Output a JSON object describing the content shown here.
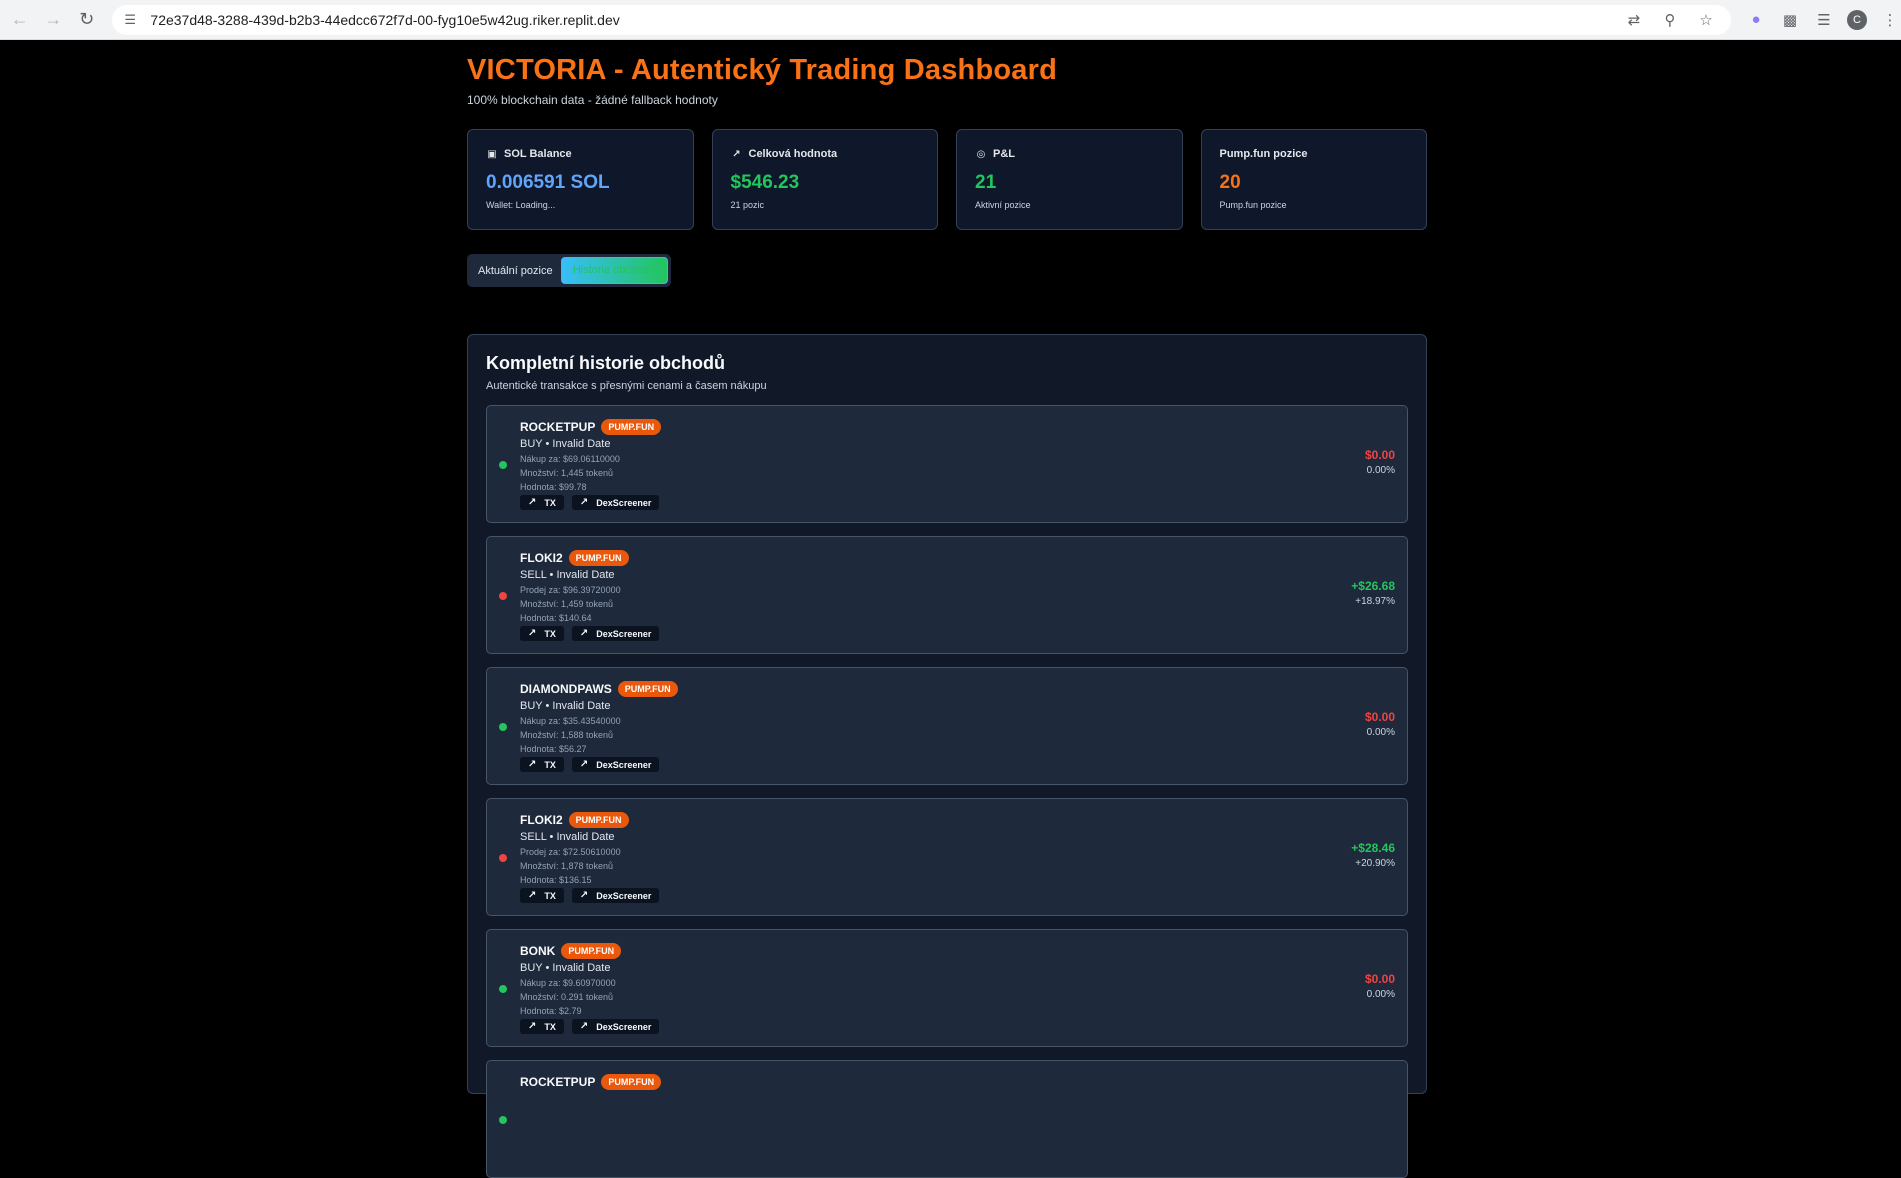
{
  "browser": {
    "url": "72e37d48-3288-439d-b2b3-44edcc672f7d-00-fyg10e5w42ug.riker.replit.dev",
    "avatar_letter": "C"
  },
  "header": {
    "title": "VICTORIA - Autentický Trading Dashboard",
    "subtitle": "100% blockchain data - žádné fallback hodnoty"
  },
  "stats": [
    {
      "label": "SOL Balance",
      "icon": "wallet-icon",
      "value": "0.006591 SOL",
      "sub": "Wallet: Loading...",
      "color": "#60a5fa"
    },
    {
      "label": "Celková hodnota",
      "icon": "trending-up-icon",
      "value": "$546.23",
      "sub": "21 pozic",
      "color": "#22c55e"
    },
    {
      "label": "P&L",
      "icon": "target-icon",
      "value": "21",
      "sub": "Aktivní pozice",
      "color": "#22c55e"
    },
    {
      "label": "Pump.fun pozice",
      "icon": "",
      "value": "20",
      "sub": "Pump.fun pozice",
      "color": "#f97316"
    }
  ],
  "tabs": {
    "items": [
      "Aktuální pozice",
      "Historie obchodů"
    ],
    "active": 1
  },
  "history": {
    "title": "Kompletní historie obchodů",
    "subtitle": "Autentické transakce s přesnými cenami a časem nákupu",
    "trades": [
      {
        "token": "ROCKETPUP",
        "badge": "PUMP.FUN",
        "side": "BUY • Invalid Date",
        "price": "Nákup za: $69.06110000",
        "qty": "Množství: 1,445 tokenů",
        "value": "Hodnota: $99.78",
        "pnl": "$0.00",
        "pct": "0.00%",
        "pnl_color": "#ef4444",
        "dot_color": "#22c55e"
      },
      {
        "token": "FLOKI2",
        "badge": "PUMP.FUN",
        "side": "SELL • Invalid Date",
        "price": "Prodej za: $96.39720000",
        "qty": "Množství: 1,459 tokenů",
        "value": "Hodnota: $140.64",
        "pnl": "+$26.68",
        "pct": "+18.97%",
        "pnl_color": "#22c55e",
        "dot_color": "#ef4444"
      },
      {
        "token": "DIAMONDPAWS",
        "badge": "PUMP.FUN",
        "side": "BUY • Invalid Date",
        "price": "Nákup za: $35.43540000",
        "qty": "Množství: 1,588 tokenů",
        "value": "Hodnota: $56.27",
        "pnl": "$0.00",
        "pct": "0.00%",
        "pnl_color": "#ef4444",
        "dot_color": "#22c55e"
      },
      {
        "token": "FLOKI2",
        "badge": "PUMP.FUN",
        "side": "SELL • Invalid Date",
        "price": "Prodej za: $72.50610000",
        "qty": "Množství: 1,878 tokenů",
        "value": "Hodnota: $136.15",
        "pnl": "+$28.46",
        "pct": "+20.90%",
        "pnl_color": "#22c55e",
        "dot_color": "#ef4444"
      },
      {
        "token": "BONK",
        "badge": "PUMP.FUN",
        "side": "BUY • Invalid Date",
        "price": "Nákup za: $9.60970000",
        "qty": "Množství: 0.291 tokenů",
        "value": "Hodnota: $2.79",
        "pnl": "$0.00",
        "pct": "0.00%",
        "pnl_color": "#ef4444",
        "dot_color": "#22c55e"
      },
      {
        "token": "ROCKETPUP",
        "badge": "PUMP.FUN",
        "side": "",
        "price": "",
        "qty": "",
        "value": "",
        "pnl": "",
        "pct": "",
        "pnl_color": "#ef4444",
        "dot_color": "#22c55e"
      }
    ],
    "link_tx": "TX",
    "link_dex": "DexScreener"
  }
}
